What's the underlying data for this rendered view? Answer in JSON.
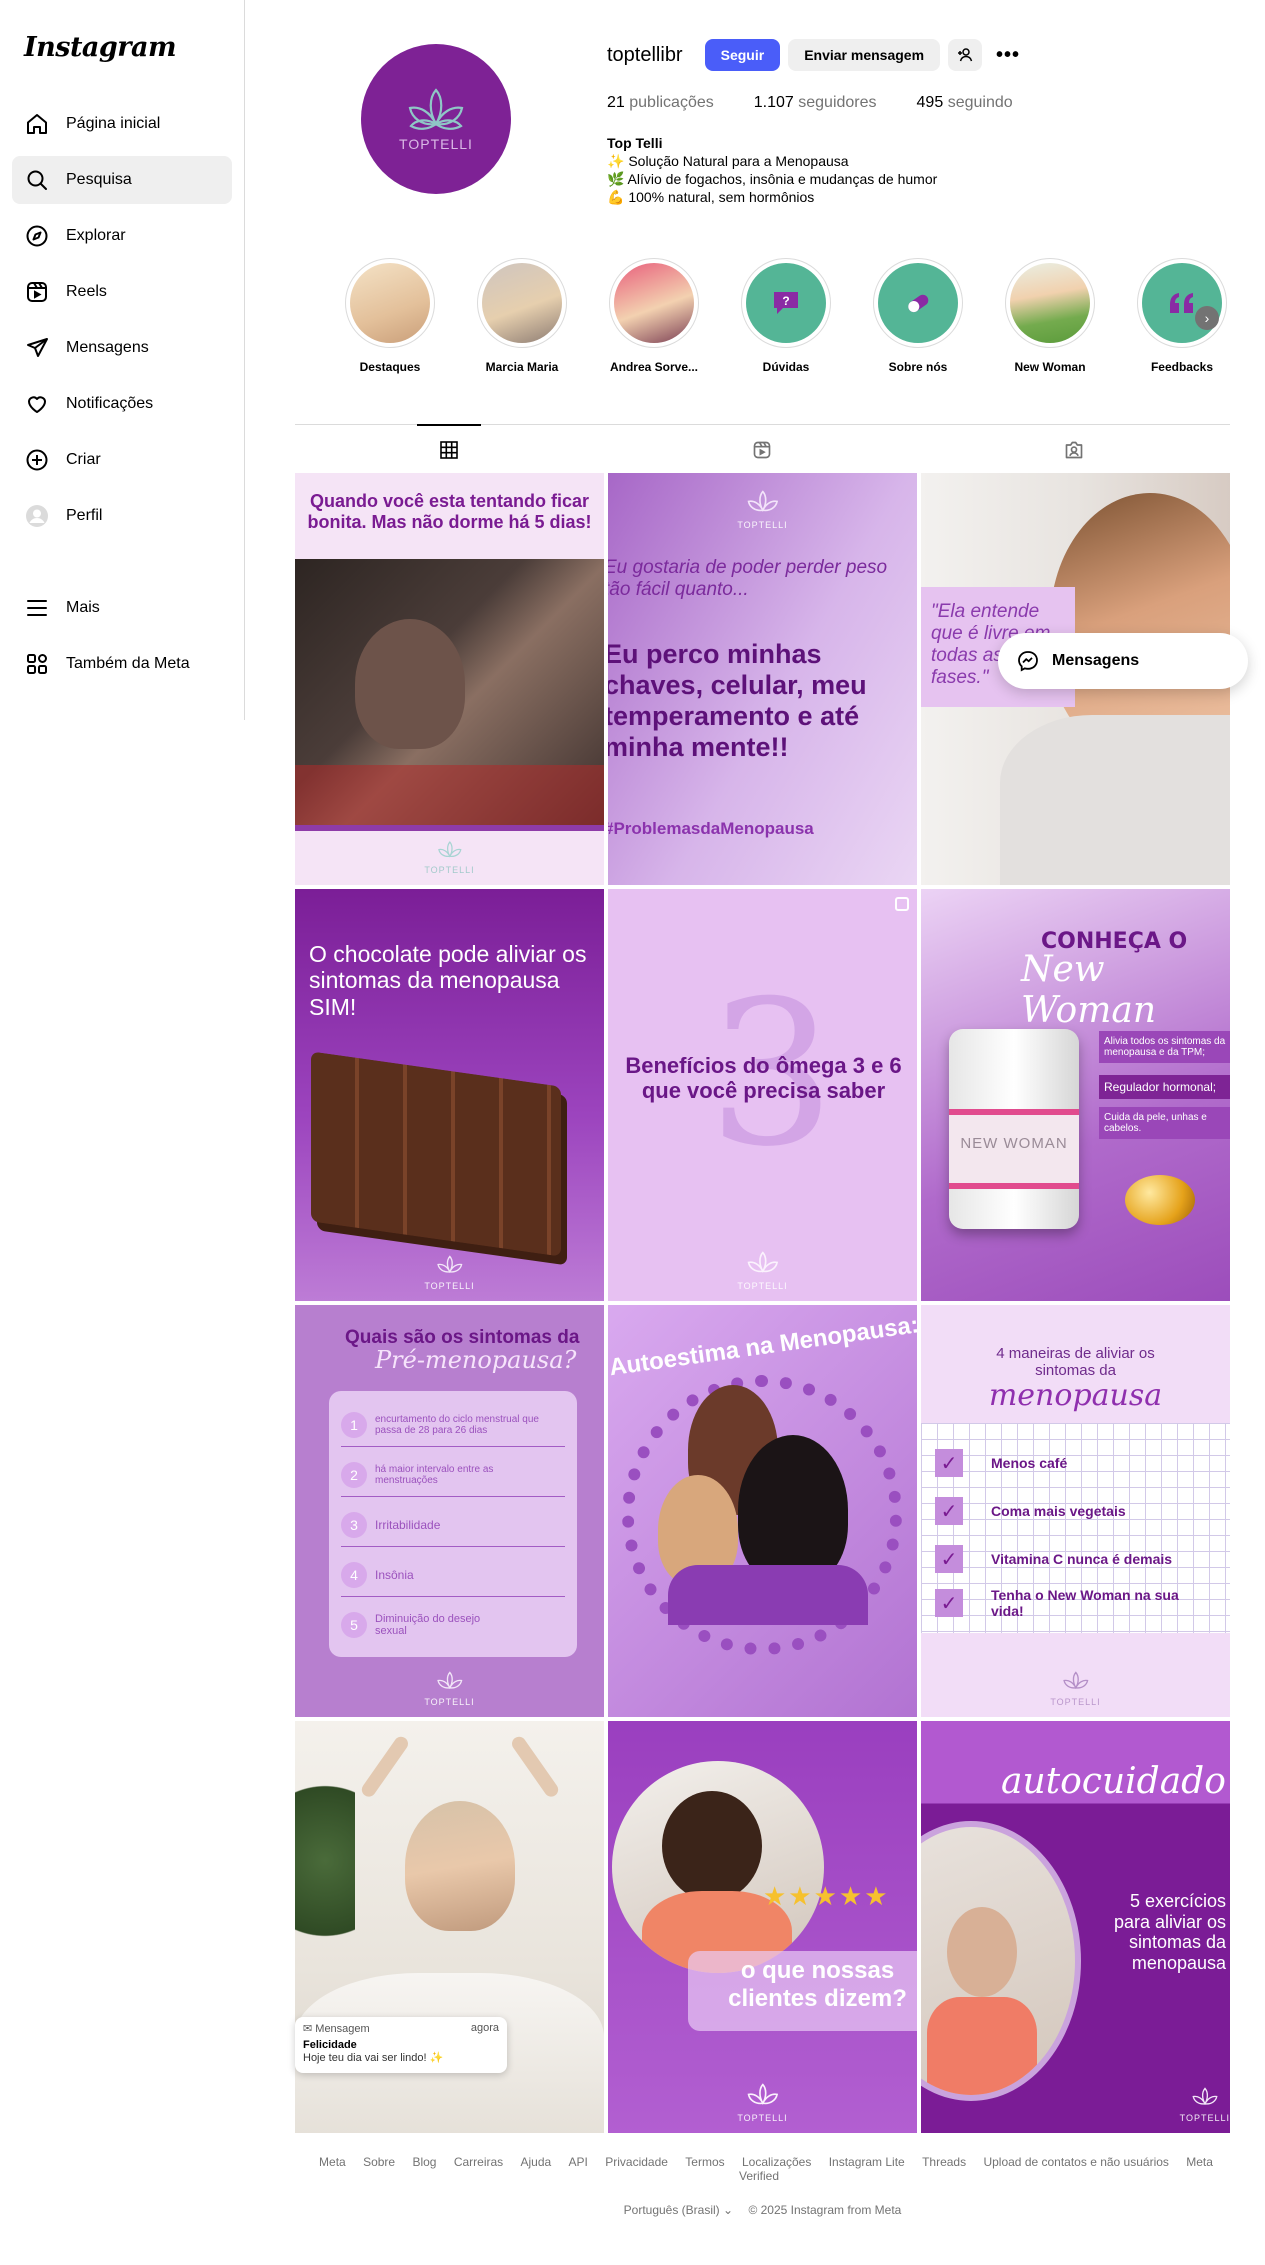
{
  "app": {
    "name": "Instagram"
  },
  "sidebar": {
    "items": [
      {
        "label": "Página inicial",
        "icon": "home-icon"
      },
      {
        "label": "Pesquisa",
        "icon": "search-icon"
      },
      {
        "label": "Explorar",
        "icon": "compass-icon"
      },
      {
        "label": "Reels",
        "icon": "reels-icon"
      },
      {
        "label": "Mensagens",
        "icon": "paper-plane-icon"
      },
      {
        "label": "Notificações",
        "icon": "heart-icon"
      },
      {
        "label": "Criar",
        "icon": "plus-square-icon"
      },
      {
        "label": "Perfil",
        "icon": "avatar-icon"
      }
    ],
    "bottom": [
      {
        "label": "Mais",
        "icon": "menu-icon"
      },
      {
        "label": "Também da Meta",
        "icon": "meta-apps-icon"
      }
    ]
  },
  "profile": {
    "username": "toptellibr",
    "follow_label": "Seguir",
    "message_label": "Enviar mensagem",
    "avatar_text": "TOPTELLI",
    "posts_count": "21",
    "posts_label": "publicações",
    "followers_count": "1.107",
    "followers_label": "seguidores",
    "following_count": "495",
    "following_label": "seguindo",
    "bio_name": "Top Telli",
    "bio_lines": [
      "✨ Solução Natural para a Menopausa",
      "🌿 Alívio de fogachos, insônia e mudanças de humor",
      "💪 100% natural, sem hormônios"
    ]
  },
  "highlights": [
    {
      "label": "Destaques"
    },
    {
      "label": "Marcia Maria"
    },
    {
      "label": "Andrea Sorve..."
    },
    {
      "label": "Dúvidas"
    },
    {
      "label": "Sobre nós"
    },
    {
      "label": "New Woman"
    },
    {
      "label": "Feedbacks"
    }
  ],
  "posts": [
    {
      "caption": "Quando você esta tentando ficar bonita. Mas não dorme há 5 dias!"
    },
    {
      "caption_a": "Eu gostaria de poder perder peso tão fácil quanto...",
      "caption_b": "Eu perco minhas chaves, celular, meu temperamento e até minha mente!!",
      "caption_c": "#ProblemasdaMenopausa"
    },
    {
      "caption": "\"Ela entende que é livre em todas as suas fases.\""
    },
    {
      "caption": "O chocolate pode aliviar os sintomas da menopausa SIM!"
    },
    {
      "caption": "Benefícios do ômega 3 e 6 que você precisa saber"
    },
    {
      "caption_a": "CONHEÇA O",
      "caption_b": "New Woman",
      "bullets": [
        "Alivia todos os sintomas da menopausa e da TPM;",
        "Regulador hormonal;",
        "Cuida da pele, unhas e cabelos."
      ],
      "product": "NEW WOMAN"
    },
    {
      "title_a": "Quais são os sintomas da",
      "title_b": "Pré-menopausa?",
      "items": [
        "encurtamento do ciclo menstrual que passa de 28 para 26 dias",
        "há maior intervalo entre as menstruações",
        "Irritabilidade",
        "Insônia",
        "Diminuição do desejo sexual"
      ]
    },
    {
      "caption": "Autoestima na Menopausa: Co"
    },
    {
      "title_a": "4 maneiras de aliviar os sintomas da",
      "title_b": "menopausa",
      "items": [
        "Menos café",
        "Coma mais vegetais",
        "Vitamina C nunca é demais",
        "Tenha o New Woman na sua vida!"
      ]
    },
    {
      "caption": ""
    },
    {
      "caption": "o que nossas clientes dizem?"
    },
    {
      "caption_a": "autocuidado",
      "caption_b": "5 exercícios para aliviar os sintomas da menopausa"
    }
  ],
  "brand_mark": "TOPTELLI",
  "messages_pill": {
    "label": "Mensagens"
  },
  "toast": {
    "app": "Mensagem",
    "time": "agora",
    "title": "Felicidade",
    "body": "Hoje teu dia vai ser lindo! ✨"
  },
  "footer": {
    "links": [
      "Meta",
      "Sobre",
      "Blog",
      "Carreiras",
      "Ajuda",
      "API",
      "Privacidade",
      "Termos",
      "Localizações",
      "Instagram Lite",
      "Threads",
      "Upload de contatos e não usuários",
      "Meta Verified"
    ],
    "language": "Português (Brasil)",
    "copyright": "© 2025 Instagram from Meta"
  },
  "colors": {
    "accent": "#4a5df9",
    "brand_purple": "#7e2295",
    "light_purple": "#e9c7f3"
  }
}
